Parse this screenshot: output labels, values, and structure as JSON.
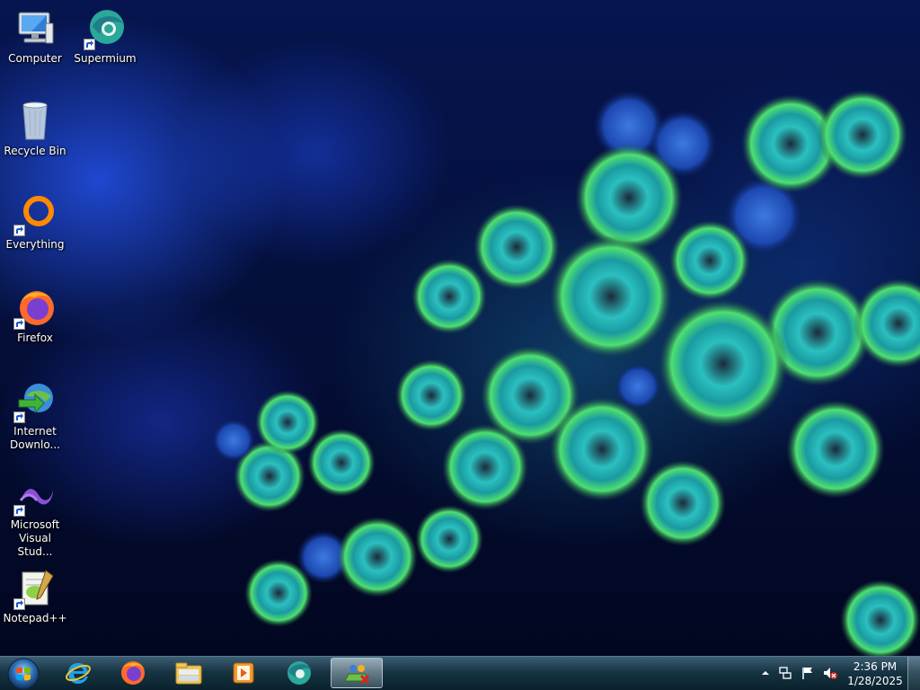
{
  "desktop": {
    "icons": [
      {
        "label": "Computer",
        "icon": "computer-icon"
      },
      {
        "label": "Supermium",
        "icon": "supermium-icon"
      },
      {
        "label": "Recycle Bin",
        "icon": "recycle-bin-icon"
      },
      {
        "label": "Everything",
        "icon": "everything-icon"
      },
      {
        "label": "Firefox",
        "icon": "firefox-icon"
      },
      {
        "label": "Internet Downlo...",
        "icon": "internet-download-manager-icon"
      },
      {
        "label": "Microsoft Visual Stud...",
        "icon": "visual-studio-icon"
      },
      {
        "label": "Notepad++",
        "icon": "notepad-plus-plus-icon"
      }
    ]
  },
  "taskbar": {
    "start_icon": "windows-start-orb-icon",
    "pinned": [
      {
        "icon": "internet-explorer-icon"
      },
      {
        "icon": "firefox-icon"
      },
      {
        "icon": "file-explorer-icon"
      },
      {
        "icon": "media-player-icon"
      },
      {
        "icon": "supermium-icon"
      },
      {
        "icon": "network-app-icon",
        "active": true
      }
    ],
    "tray": {
      "icons": [
        "show-hidden-icons-chevron",
        "network-icon",
        "action-center-flag-icon",
        "volume-muted-icon"
      ],
      "time": "2:36 PM",
      "date": "1/28/2025"
    }
  },
  "colors": {
    "taskbar_active": "#c8dce4",
    "wallpaper_base": "#06154f",
    "coral_green": "#3fe06a",
    "coral_cyan": "#1fb8c0"
  }
}
